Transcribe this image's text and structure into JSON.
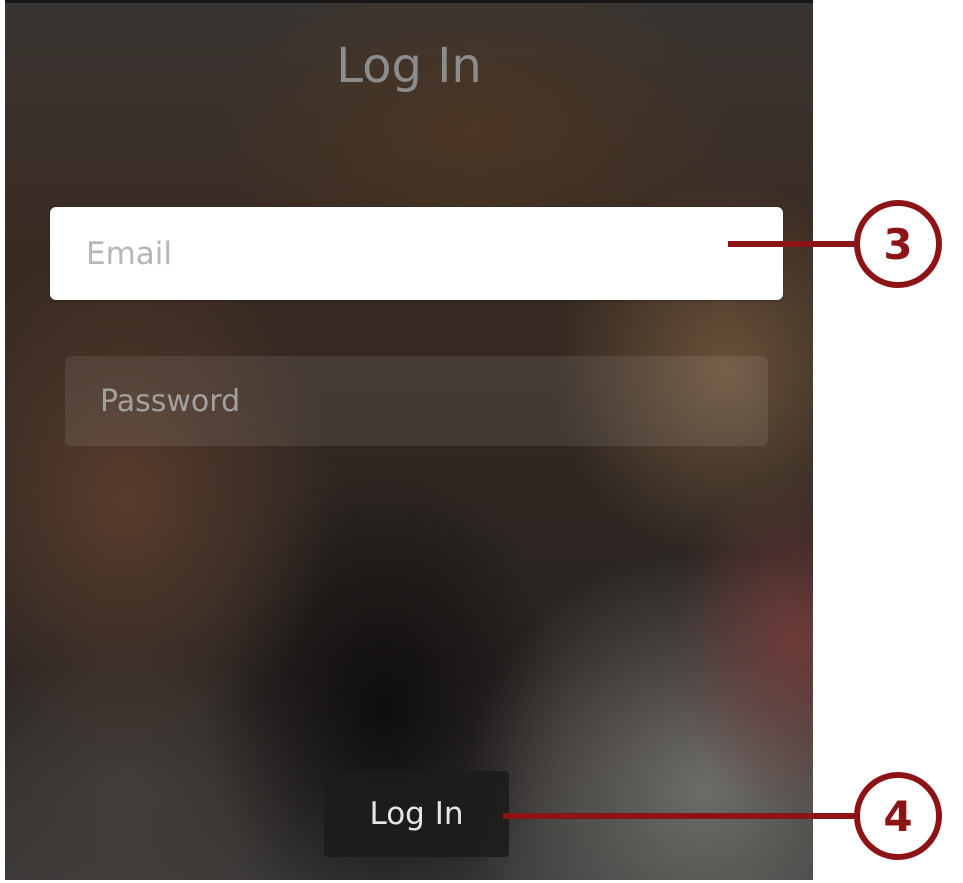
{
  "screen": {
    "title": "Log In",
    "email_field": {
      "placeholder": "Email",
      "value": ""
    },
    "password_field": {
      "placeholder": "Password",
      "value": ""
    },
    "login_button": {
      "label": "Log In"
    }
  },
  "callouts": [
    {
      "label": "3",
      "points_to": "email-field"
    },
    {
      "label": "4",
      "points_to": "login-button"
    }
  ],
  "colors": {
    "callout": "#8d1416",
    "email_field_background": "#ffffff",
    "title_text": "#8c8c8c",
    "placeholder_text": "#b6b6b8",
    "button_background": "#1c1c1c",
    "button_text": "#e6e6e6"
  }
}
